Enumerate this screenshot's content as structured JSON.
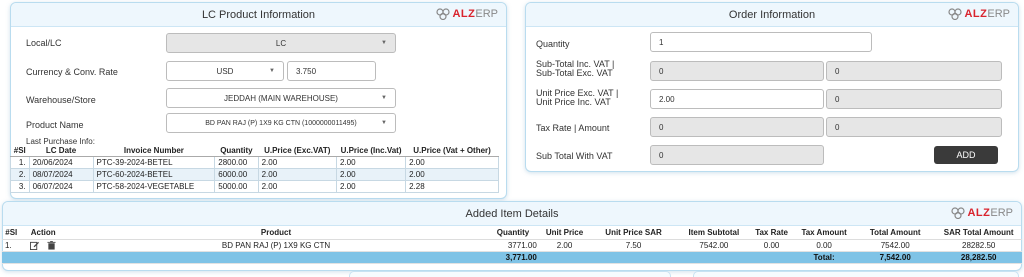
{
  "brand": {
    "logo_main": "ALZ",
    "logo_suffix": "ERP",
    "accent": "#d9232d",
    "header_bg": "#eef7fd",
    "total_row_bg": "#7fc3e6"
  },
  "lc_panel": {
    "title": "LC Product Information",
    "local_lc": {
      "label": "Local/LC",
      "value": "LC"
    },
    "currency": {
      "label": "Currency & Conv. Rate",
      "value": "USD",
      "rate": "3.750"
    },
    "warehouse": {
      "label": "Warehouse/Store",
      "value": "JEDDAH (MAIN WAREHOUSE)"
    },
    "product": {
      "label": "Product Name",
      "value": "BD PAN RAJ (P) 1X9 KG CTN (1000000011495)"
    },
    "last_purchase_label": "Last Purchase Info:",
    "last_purchase_columns": [
      "#Sl",
      "LC Date",
      "Invoice Number",
      "Quantity",
      "U.Price (Exc.VAT)",
      "U.Price (Inc.Vat)",
      "U.Price (Vat + Other)"
    ],
    "last_purchase_rows": [
      [
        "1.",
        "20/06/2024",
        "PTC-39-2024-BETEL",
        "2800.00",
        "2.00",
        "2.00",
        "2.00"
      ],
      [
        "2.",
        "08/07/2024",
        "PTC-60-2024-BETEL",
        "6000.00",
        "2.00",
        "2.00",
        "2.00"
      ],
      [
        "3.",
        "06/07/2024",
        "PTC-58-2024-VEGETABLE",
        "5000.00",
        "2.00",
        "2.00",
        "2.28"
      ]
    ]
  },
  "order_panel": {
    "title": "Order Information",
    "quantity": {
      "label": "Quantity",
      "value": "1"
    },
    "subtotal": {
      "label_line1": "Sub-Total Inc. VAT |",
      "label_line2": "Sub-Total Exc. VAT",
      "value1": "0",
      "value2": "0"
    },
    "unit_price": {
      "label_line1": "Unit Price Exc. VAT |",
      "label_line2": "Unit Price Inc. VAT",
      "value1": "2.00",
      "value2": "0"
    },
    "tax": {
      "label": "Tax Rate | Amount",
      "value1": "0",
      "value2": "0"
    },
    "subtotal_vat": {
      "label": "Sub Total With VAT",
      "value": "0"
    },
    "add_button": "ADD"
  },
  "items_panel": {
    "title": "Added Item Details",
    "columns": [
      "#Sl",
      "Action",
      "Product",
      "Quantity",
      "Unit Price",
      "Unit Price SAR",
      "Item Subtotal",
      "Tax Rate",
      "Tax Amount",
      "Total Amount",
      "SAR Total Amount"
    ],
    "rows": [
      {
        "sl": "1.",
        "product": "BD PAN RAJ (P) 1X9 KG CTN",
        "quantity": "3771.00",
        "unit_price": "2.00",
        "unit_price_sar": "7.50",
        "item_subtotal": "7542.00",
        "tax_rate": "0.00",
        "tax_amount": "0.00",
        "total_amount": "7542.00",
        "sar_total_amount": "28282.50"
      }
    ],
    "totals": {
      "quantity": "3,771.00",
      "label": "Total:",
      "total_amount": "7,542.00",
      "sar_total_amount": "28,282.50"
    }
  }
}
